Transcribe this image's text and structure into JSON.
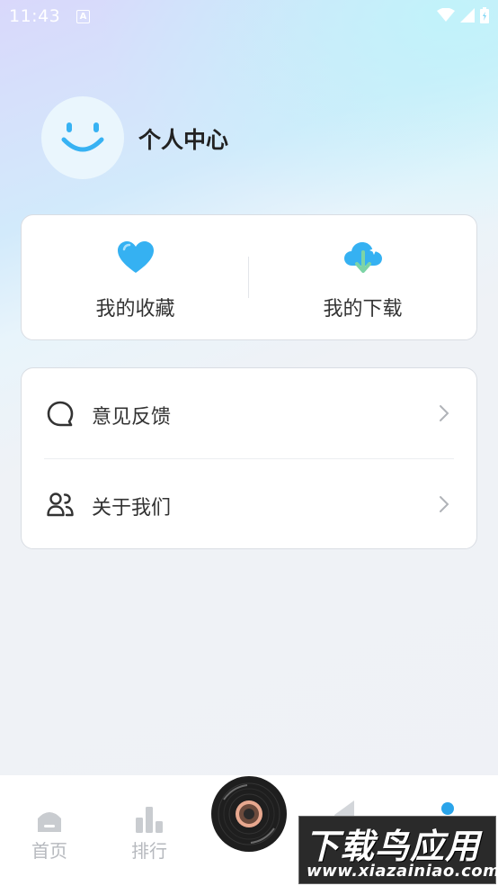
{
  "status_bar": {
    "time": "11:43",
    "badge": "A"
  },
  "profile": {
    "title": "个人中心",
    "avatar_icon": "smiley-icon"
  },
  "quick_actions": [
    {
      "label": "我的收藏",
      "icon": "heart-icon"
    },
    {
      "label": "我的下载",
      "icon": "cloud-download-icon"
    }
  ],
  "menu": [
    {
      "label": "意见反馈",
      "icon": "chat-bubble-icon"
    },
    {
      "label": "关于我们",
      "icon": "users-icon"
    }
  ],
  "bottom_nav": [
    {
      "label": "首页",
      "icon": "home-icon"
    },
    {
      "label": "排行",
      "icon": "bar-chart-icon"
    }
  ],
  "watermark": {
    "title": "下载鸟应用",
    "url": "www.xiazainiao.com"
  },
  "colors": {
    "accent": "#35b1f2",
    "text": "#333333",
    "nav_inactive": "#b6b9be"
  }
}
